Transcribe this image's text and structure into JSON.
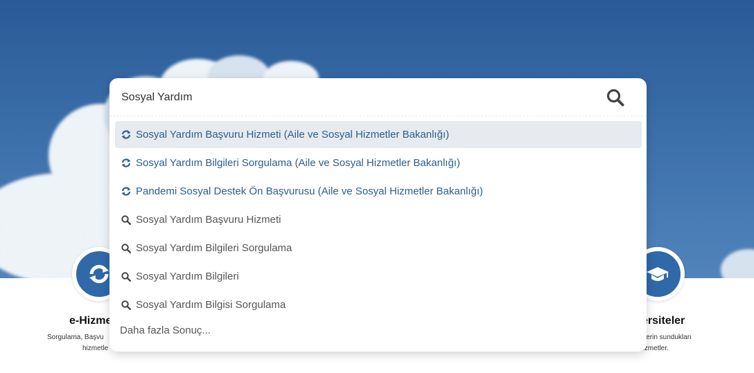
{
  "search": {
    "value": "Sosyal Yardım",
    "icon": "search-icon"
  },
  "suggestions": [
    {
      "text": "Sosyal Yardım Başvuru Hizmeti (Aile ve Sosyal Hizmetler Bakanlığı)",
      "type": "service",
      "icon": "e-service-icon",
      "active": true
    },
    {
      "text": "Sosyal Yardım Bilgileri Sorgulama (Aile ve Sosyal Hizmetler Bakanlığı)",
      "type": "service",
      "icon": "e-service-icon"
    },
    {
      "text": "Pandemi Sosyal Destek Ön Başvurusu (Aile ve Sosyal Hizmetler Bakanlığı)",
      "type": "service",
      "icon": "e-service-icon"
    },
    {
      "text": "Sosyal Yardım Başvuru Hizmeti",
      "type": "query",
      "icon": "search-icon"
    },
    {
      "text": "Sosyal Yardım Bilgileri Sorgulama",
      "type": "query",
      "icon": "search-icon"
    },
    {
      "text": "Sosyal Yardım Bilgileri",
      "type": "query",
      "icon": "search-icon"
    },
    {
      "text": "Sosyal Yardım Bilgisi Sorgulama",
      "type": "query",
      "icon": "search-icon"
    }
  ],
  "more_results": "Daha fazla Sonuç...",
  "background": {
    "left_card": {
      "title": "e-Hizme",
      "desc_line1": "Sorgulama, Başvu",
      "desc_line2": "hizmetle"
    },
    "right_card": {
      "title": "ersiteler",
      "desc_line1": "lerin sundukları",
      "desc_line2": "hizmetler."
    }
  },
  "colors": {
    "accent": "#2f69a9",
    "service_text": "#2b5f8e",
    "active_bg": "#e7eaee"
  }
}
